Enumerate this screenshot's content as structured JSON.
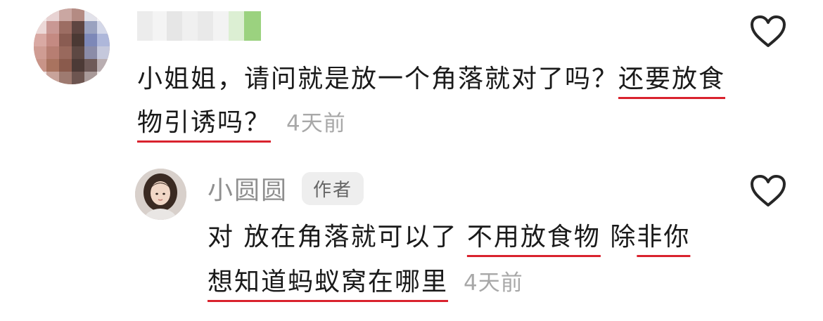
{
  "comments": [
    {
      "text_parts": [
        "小姐姐，请问就是放一个角落就对了吗？",
        "还要放食物引诱吗？"
      ],
      "time": "4天前",
      "like_icon": "heart-outline-icon",
      "avatar_icon": "pixelated-avatar"
    },
    {
      "author": "小圆圆",
      "badge": "作者",
      "text_parts": [
        "对 放在角落就可以了 ",
        "不用放食物",
        " 除",
        "非你想知道蚂蚁窝在哪里"
      ],
      "time": "4天前",
      "like_icon": "heart-outline-icon",
      "avatar_icon": "user-photo-avatar"
    }
  ],
  "colors": {
    "underline": "#d9232e",
    "text": "#1a1a1a",
    "muted": "#a8a8a8",
    "author": "#8f8f8f",
    "badge_bg": "#eeeeee"
  }
}
